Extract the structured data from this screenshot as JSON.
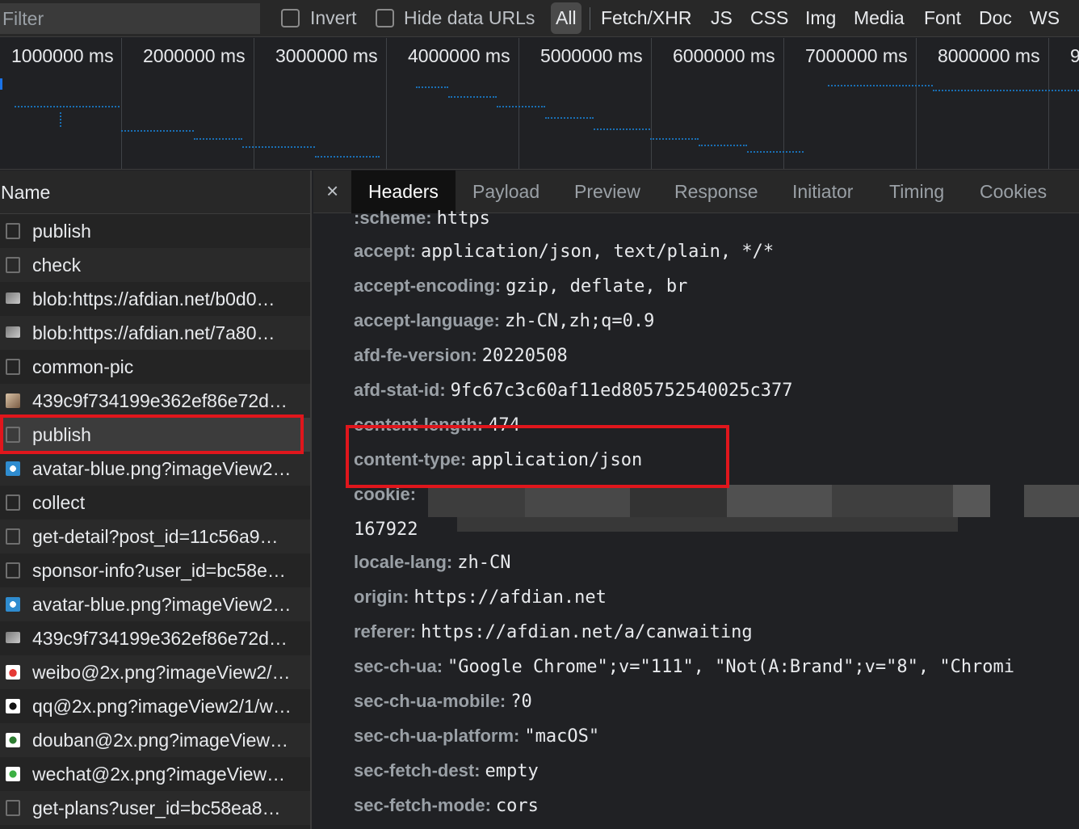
{
  "filterbar": {
    "placeholder": "Filter",
    "invert_label": "Invert",
    "hide_data_urls_label": "Hide data URLs",
    "types": [
      "All",
      "Fetch/XHR",
      "JS",
      "CSS",
      "Img",
      "Media",
      "Font",
      "Doc",
      "WS"
    ]
  },
  "timeline": {
    "ticks": [
      "1000000 ms",
      "2000000 ms",
      "3000000 ms",
      "4000000 ms",
      "5000000 ms",
      "6000000 ms",
      "7000000 ms",
      "8000000 ms",
      "9"
    ]
  },
  "requests": {
    "header": "Name",
    "rows": [
      {
        "name": "publish",
        "icon": "doc"
      },
      {
        "name": "check",
        "icon": "doc"
      },
      {
        "name": "blob:https://afdian.net/b0d0…",
        "icon": "img"
      },
      {
        "name": "blob:https://afdian.net/7a80…",
        "icon": "img"
      },
      {
        "name": "common-pic",
        "icon": "doc"
      },
      {
        "name": "439c9f734199e362ef86e72d…",
        "icon": "img photo"
      },
      {
        "name": "publish",
        "icon": "doc"
      },
      {
        "name": "avatar-blue.png?imageView2…",
        "icon": "img blue"
      },
      {
        "name": "collect",
        "icon": "doc"
      },
      {
        "name": "get-detail?post_id=11c56a9…",
        "icon": "doc"
      },
      {
        "name": "sponsor-info?user_id=bc58e…",
        "icon": "doc"
      },
      {
        "name": "avatar-blue.png?imageView2…",
        "icon": "img blue"
      },
      {
        "name": "439c9f734199e362ef86e72d…",
        "icon": "img"
      },
      {
        "name": "weibo@2x.png?imageView2/…",
        "icon": "img red"
      },
      {
        "name": "qq@2x.png?imageView2/1/w…",
        "icon": "img qq"
      },
      {
        "name": "douban@2x.png?imageView…",
        "icon": "img green"
      },
      {
        "name": "wechat@2x.png?imageView…",
        "icon": "img wechat"
      },
      {
        "name": "get-plans?user_id=bc58ea8…",
        "icon": "doc"
      }
    ]
  },
  "detail": {
    "close": "×",
    "tabs": [
      "Headers",
      "Payload",
      "Preview",
      "Response",
      "Initiator",
      "Timing",
      "Cookies"
    ],
    "headers": [
      {
        "name": ":scheme:",
        "value": "https"
      },
      {
        "name": "accept:",
        "value": "application/json, text/plain, */*"
      },
      {
        "name": "accept-encoding:",
        "value": "gzip, deflate, br"
      },
      {
        "name": "accept-language:",
        "value": "zh-CN,zh;q=0.9"
      },
      {
        "name": "afd-fe-version:",
        "value": "20220508"
      },
      {
        "name": "afd-stat-id:",
        "value": "9fc67c3c60af11ed805752540025c377"
      },
      {
        "name": "content-length:",
        "value": "474"
      },
      {
        "name": "content-type:",
        "value": "application/json"
      },
      {
        "name": "cookie:",
        "value": ""
      },
      {
        "name": "",
        "value": "167922"
      },
      {
        "name": "locale-lang:",
        "value": "zh-CN"
      },
      {
        "name": "origin:",
        "value": "https://afdian.net"
      },
      {
        "name": "referer:",
        "value": "https://afdian.net/a/canwaiting"
      },
      {
        "name": "sec-ch-ua:",
        "value": "\"Google Chrome\";v=\"111\", \"Not(A:Brand\";v=\"8\", \"Chromi"
      },
      {
        "name": "sec-ch-ua-mobile:",
        "value": "?0"
      },
      {
        "name": "sec-ch-ua-platform:",
        "value": "\"macOS\""
      },
      {
        "name": "sec-fetch-dest:",
        "value": "empty"
      },
      {
        "name": "sec-fetch-mode:",
        "value": "cors"
      }
    ]
  },
  "colors": {
    "highlight": "#e0161c",
    "waterfall": "#1a73e8"
  }
}
